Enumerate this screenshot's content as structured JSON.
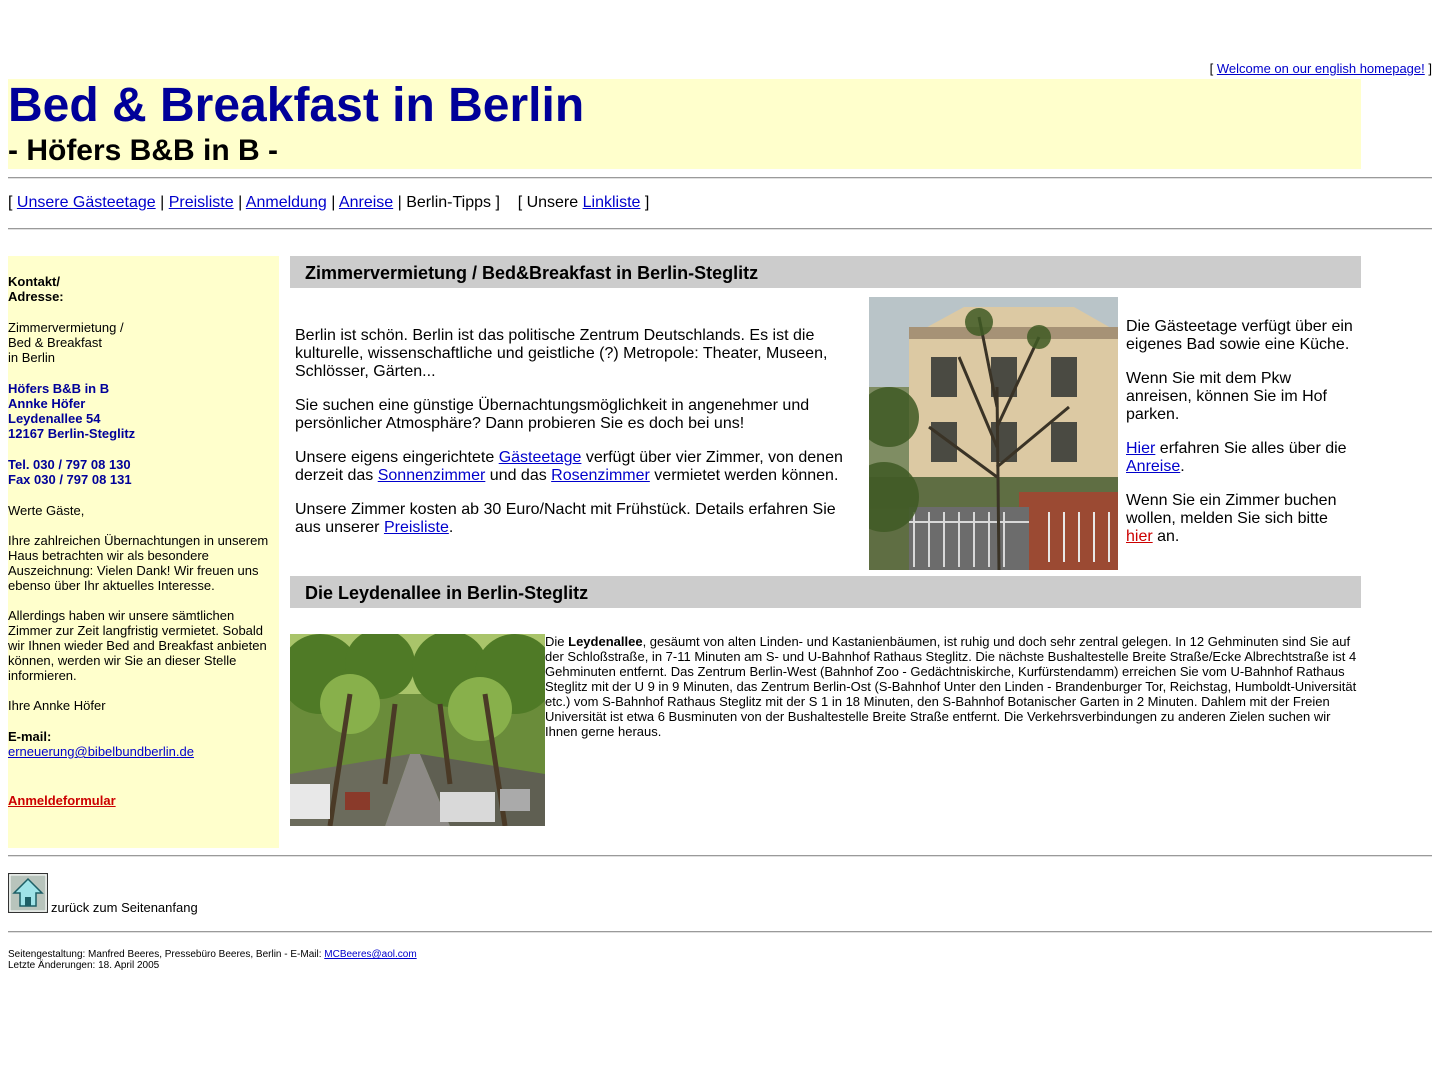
{
  "top_link": {
    "open": "[",
    "label": "Welcome on our english homepage!",
    "close": "]"
  },
  "header": {
    "title": "Bed & Breakfast in Berlin",
    "subtitle": "- Höfers B&B in B -"
  },
  "nav": {
    "open": "[",
    "items": [
      "Unsere Gästeetage",
      "Preisliste",
      "Anmeldung",
      "Anreise"
    ],
    "sep": "|",
    "current": "Berlin-Tipps",
    "close": "]",
    "links_prefix": "[ Unsere",
    "links_label": "Linkliste",
    "links_close": "]"
  },
  "sidebar": {
    "contact_heading": "Kontakt/",
    "contact_heading2": "Adresse:",
    "desc": [
      "Zimmervermietung /",
      "Bed & Breakfast",
      "in Berlin"
    ],
    "address": [
      "Höfers B&B in B",
      "Annke Höfer",
      "Leydenallee 54",
      "12167 Berlin-Steglitz"
    ],
    "phones": [
      "Tel. 030 / 797 08 130",
      "Fax 030 / 797 08 131"
    ],
    "greeting": "Werte Gäste,",
    "para1": "Ihre zahlreichen Übernachtungen in unserem Haus betrachten wir als besondere Auszeichnung: Vielen Dank! Wir freuen uns ebenso über Ihr aktuelles Interesse.",
    "para2": "Allerdings haben wir unsere sämtlichen Zimmer zur Zeit langfristig vermietet. Sobald wir Ihnen wieder Bed and Breakfast anbieten können, werden wir Sie an dieser Stelle informieren.",
    "signature": "Ihre Annke Höfer",
    "email_label": "E-mail:",
    "email": "erneuerung@bibelbundberlin.de",
    "form_link": "Anmeldeformular"
  },
  "section1": {
    "heading": "Zimmervermietung / Bed&Breakfast in Berlin-Steglitz",
    "p1": "Berlin ist schön. Berlin ist das politische Zentrum Deutschlands. Es ist die kulturelle, wissenschaftliche und geistliche (?) Metropole: Theater, Museen, Schlösser, Gärten...",
    "p2": "Sie suchen eine günstige Übernachtungsmöglichkeit in angenehmer und persönlicher Atmosphäre? Dann probieren Sie es doch bei uns!",
    "p3a": "Unsere eigens eingerichtete ",
    "p3_link1": "Gästeetage",
    "p3b": " verfügt über vier Zimmer, von denen derzeit das ",
    "p3_link2": "Sonnenzimmer",
    "p3c": " und das ",
    "p3_link3": "Rosenzimmer",
    "p3d": " vermietet werden können.",
    "p4a": "Unsere Zimmer kosten ab 30 Euro/Nacht mit Frühstück. Details erfahren Sie aus unserer ",
    "p4_link": "Preisliste",
    "p4b": ".",
    "r1": "Die Gästeetage verfügt über ein eigenes Bad sowie eine Küche.",
    "r2": "Wenn Sie mit dem Pkw anreisen, können Sie im Hof parken.",
    "r3_link": "Hier",
    "r3a": " erfahren Sie alles über die ",
    "r3_link2": "Anreise",
    "r3b": ".",
    "r4a": "Wenn Sie ein Zimmer buchen wollen, melden Sie sich bitte ",
    "r4_link": "hier",
    "r4b": " an."
  },
  "section2": {
    "heading": "Die Leydenallee in Berlin-Steglitz",
    "lead": "Die ",
    "street": "Leydenallee",
    "text": ", gesäumt von alten Linden- und Kastanienbäumen, ist ruhig und doch sehr zentral gelegen. In 12 Gehminuten sind Sie auf der Schloßstraße, in 7-11 Minuten am S- und U-Bahnhof Rathaus Steglitz. Die nächste Bushaltestelle Breite Straße/Ecke Albrechtstraße ist 4 Gehminuten entfernt. Das Zentrum Berlin-West (Bahnhof Zoo - Gedächtniskirche, Kurfürstendamm) erreichen Sie vom U-Bahnhof Rathaus Steglitz mit der U 9 in 9 Minuten, das Zentrum Berlin-Ost (S-Bahnhof Unter den Linden - Brandenburger Tor, Reichstag, Humboldt-Universität etc.) vom S-Bahnhof Rathaus Steglitz mit der S 1 in 18 Minuten, den S-Bahnhof Botanischer Garten in 2 Minuten. Dahlem mit der Freien Universität ist etwa 6 Busminuten von der Bushaltestelle Breite Straße entfernt. Die Verkehrsverbindungen zu anderen Zielen suchen wir Ihnen gerne heraus."
  },
  "footer": {
    "back_label": "zurück zum Seitenanfang",
    "credit": "Seitengestaltung: Manfred Beeres, Pressebüro Beeres, Berlin - E-Mail: ",
    "credit_email": "MCBeeres@aol.com",
    "updated": "Letzte Änderungen:  18. April 2005"
  }
}
